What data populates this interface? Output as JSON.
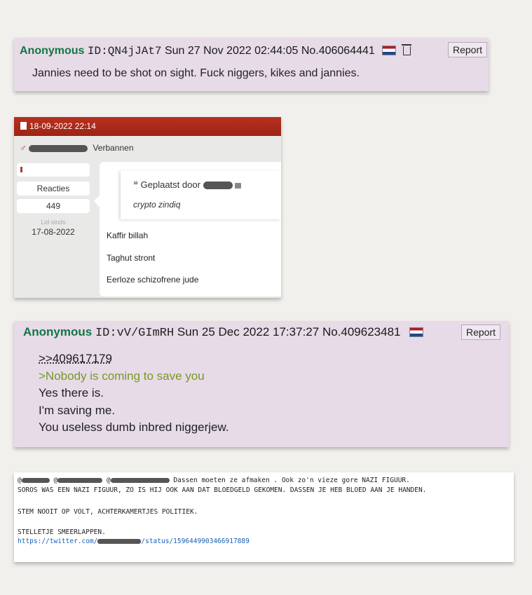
{
  "post1": {
    "name": "Anonymous",
    "id": "ID:QN4jJAt7",
    "datetime": "Sun 27 Nov 2022 02:44:05",
    "number": "No.406064441",
    "report": "Report",
    "body": "Jannies need to be shot on sight. Fuck niggers, kikes and jannies."
  },
  "forum": {
    "date": "18-09-2022 22:14",
    "status": "Verbannen",
    "reacties_label": "Reacties",
    "reacties_count": "449",
    "lid_sinds_label": "Lid sinds",
    "lid_sinds_date": "17-08-2022",
    "quote_prefix": "Geplaatst door",
    "quote_text": "crypto zindiq",
    "lines": [
      "Kaffir billah",
      "Taghut stront",
      "Eerloze schizofrene jude"
    ]
  },
  "post2": {
    "name": "Anonymous",
    "id": "ID:vV/GImRH",
    "datetime": "Sun 25 Dec 2022 17:37:27",
    "number": "No.409623481",
    "report": "Report",
    "quotelink": ">>409617179",
    "greentext": ">Nobody is coming to save you",
    "lines": [
      "Yes there is.",
      "I'm saving me.",
      "You useless dumb inbred niggerjew."
    ]
  },
  "tweet": {
    "line1_tail": "Dassen moeten ze afmaken . Ook zo'n vieze gore NAZI FIGUUR.",
    "line2": "SOROS WAS EEN NAZI FIGUUR, ZO IS HIJ OOK AAN DAT BLOEDGELD GEKOMEN. DASSEN JE HEB BLOED AAN JE HANDEN.",
    "line3": "STEM NOOIT OP VOLT, ACHTERKAMERTJES POLITIEK.",
    "line4": "STELLETJE SMEERLAPPEN.",
    "link_prefix": "https://twitter.com/",
    "link_suffix": "/status/1596449903466917889"
  }
}
